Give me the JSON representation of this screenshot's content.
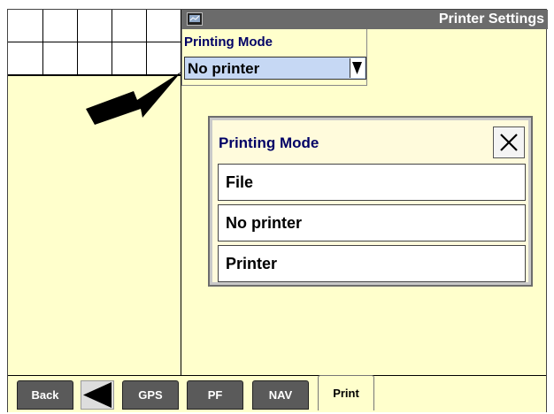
{
  "header": {
    "title": "Printer Settings",
    "icon": "display-icon"
  },
  "mode_field": {
    "label": "Printing Mode",
    "value": "No printer"
  },
  "dialog": {
    "title": "Printing Mode",
    "options": [
      {
        "label": "File"
      },
      {
        "label": "No printer"
      },
      {
        "label": "Printer"
      }
    ]
  },
  "tabs": {
    "back": "Back",
    "gps": "GPS",
    "pf": "PF",
    "nav": "NAV",
    "print": "Print"
  },
  "colors": {
    "background": "#ffffcc",
    "titlebar": "#6b6b6b",
    "select": "#c6d8f4",
    "label_text": "#000066",
    "tab": "#5a5a5a"
  }
}
